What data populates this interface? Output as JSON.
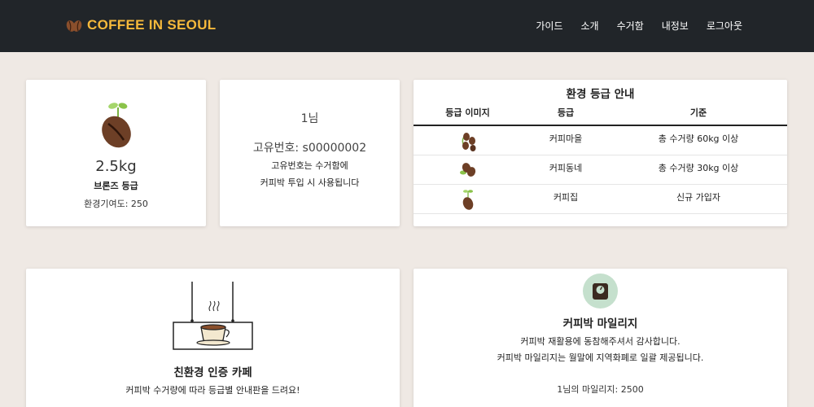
{
  "nav": {
    "brand": "COFFEE IN SEOUL",
    "links": [
      "가이드",
      "소개",
      "수거함",
      "내정보",
      "로그아웃"
    ]
  },
  "grade_card": {
    "weight": "2.5kg",
    "grade": "브론즈 등급",
    "contribution": "환경기여도: 250"
  },
  "user_card": {
    "name": "1님",
    "id": "고유번호: s00000002",
    "note_line1": "고유번호는 수거함에",
    "note_line2": "커피박 투입 시 사용됩니다"
  },
  "grade_info": {
    "title": "환경 등급 안내",
    "headers": [
      "등급 이미지",
      "등급",
      "기준"
    ],
    "rows": [
      {
        "grade": "커피마을",
        "criteria": "총 수거량 60kg 이상",
        "icon": "coffee-cluster-icon"
      },
      {
        "grade": "커피동네",
        "criteria": "총 수거량 30kg 이상",
        "icon": "coffee-pair-icon"
      },
      {
        "grade": "커피집",
        "criteria": "신규 가입자",
        "icon": "coffee-sprout-icon"
      }
    ]
  },
  "cafe_card": {
    "title": "친환경 인증 카페",
    "description": "커피박 수거량에 따라 등급별 안내판을 드려요!"
  },
  "mileage_card": {
    "title": "커피박 마일리지",
    "line1": "커피박 재활용에 동참해주셔서 감사합니다.",
    "line2": "커피박 마일리지는 월말에 지역화폐로 일괄 제공됩니다.",
    "amount": "1님의 마일리지: 2500"
  },
  "colors": {
    "navbar": "#212529",
    "brand": "#f6b93b",
    "background": "#efe9e4",
    "bean": "#6d3f26",
    "sprout": "#8bc34a",
    "mileage_circle": "#c5e0cd"
  }
}
